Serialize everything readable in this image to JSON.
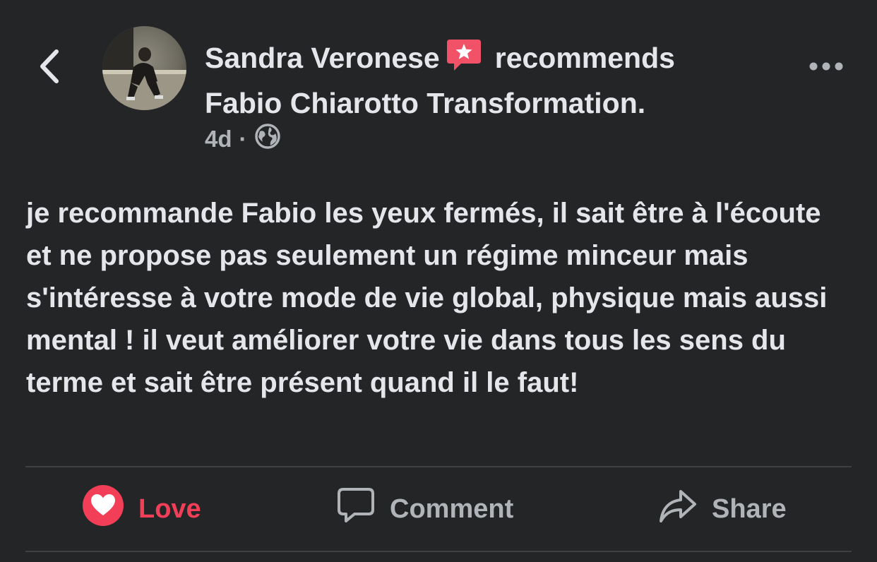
{
  "header": {
    "author_name": "Sandra Veronese",
    "verb": "recommends",
    "page_name": "Fabio Chiarotto Transformation",
    "period": ".",
    "time_ago": "4d",
    "separator": "·"
  },
  "icons": {
    "back": "chevron-left-icon",
    "recommend_badge": "recommendation-star-icon",
    "audience": "globe-icon",
    "more": "more-dots-icon"
  },
  "post": {
    "text": "je recommande Fabio les yeux fermés, il sait être à l'écoute et ne propose pas seulement un régime minceur mais s'intéresse à votre mode de vie global, physique mais aussi mental ! il veut améliorer votre vie dans tous les sens du terme et sait être présent quand il le faut!"
  },
  "actions": {
    "love_label": "Love",
    "comment_label": "Comment",
    "share_label": "Share"
  },
  "colors": {
    "background": "#242526",
    "text_primary": "#e4e6eb",
    "text_secondary": "#b0b3b8",
    "love_red": "#f33e58",
    "recommend_badge": "#f25268",
    "divider": "#3e4042"
  }
}
